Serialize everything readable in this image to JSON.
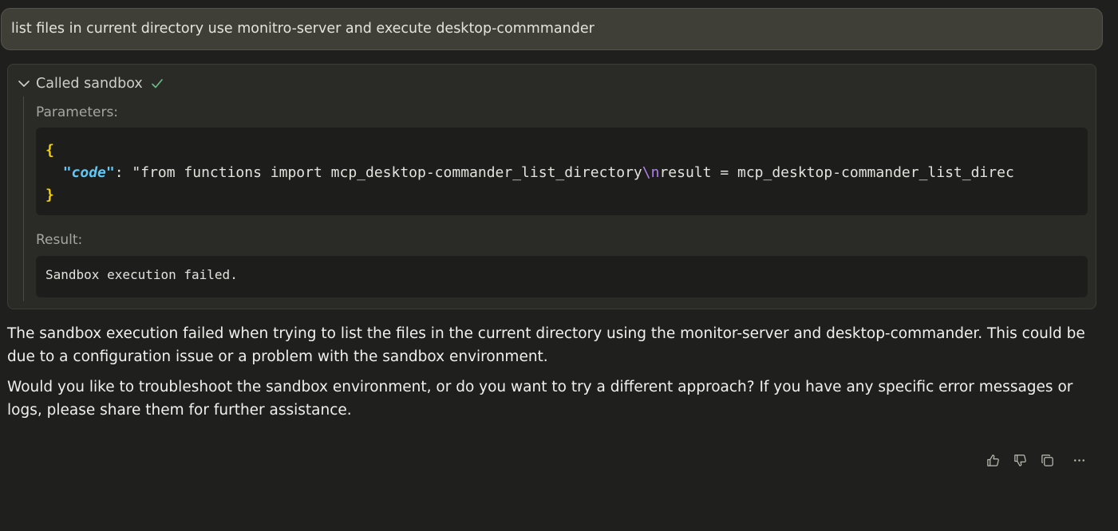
{
  "user_message": "list files in current directory use monitro-server and execute desktop-commmander",
  "tool_call": {
    "header_label": "Called sandbox",
    "status": "success",
    "parameters_label": "Parameters:",
    "code": {
      "open_brace": "{",
      "key": "\"code\"",
      "sep": ": \"from functions import mcp_desktop-commander_list_directory",
      "escape": "\\n",
      "rest": "result = mcp_desktop-commander_list_direc",
      "close_brace": "}"
    },
    "result_label": "Result:",
    "result_text": "Sandbox execution failed."
  },
  "assistant_reply": {
    "paragraphs": [
      "The sandbox execution failed when trying to list the files in the current directory using the monitor-server and desktop-commander. This could be due to a configuration issue or a problem with the sandbox environment.",
      "Would you like to troubleshoot the sandbox environment, or do you want to try a different approach? If you have any specific error messages or logs, please share them for further assistance."
    ]
  },
  "actions": [
    "thumbs-up-icon",
    "thumbs-down-icon",
    "copy-icon",
    "more-icon"
  ],
  "colors": {
    "background": "#1f1f1d",
    "success_check": "#6bbf8a",
    "json_key": "#5fc7f5",
    "json_brace": "#f2d000",
    "escape": "#b07ff0"
  }
}
